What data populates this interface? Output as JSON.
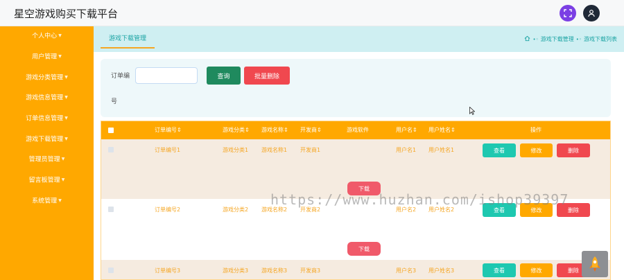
{
  "header": {
    "title": "星空游戏购买下载平台",
    "icons": [
      "expand-icon",
      "user-icon"
    ]
  },
  "sidebar": {
    "items": [
      {
        "label": "个人中心"
      },
      {
        "label": "用户管理"
      },
      {
        "label": "游戏分类管理"
      },
      {
        "label": "游戏信息管理"
      },
      {
        "label": "订单信息管理"
      },
      {
        "label": "游戏下载管理"
      },
      {
        "label": "管理员管理"
      },
      {
        "label": "留言板管理"
      },
      {
        "label": "系统管理"
      }
    ]
  },
  "tabs": {
    "active": "游戏下载管理"
  },
  "breadcrumb": {
    "items": [
      "游戏下载管理",
      "游戏下载列表"
    ]
  },
  "search": {
    "label_line1": "订单编",
    "label_line2": "号",
    "input_value": "",
    "query_button": "查询",
    "batch_delete_button": "批量删除"
  },
  "table": {
    "headers": {
      "order_no": "订单编号⇕",
      "category": "游戏分类⇕",
      "name": "游戏名称⇕",
      "developer": "开发商⇕",
      "software": "游戏软件",
      "username": "用户名⇕",
      "realname": "用户姓名⇕",
      "actions": "操作"
    },
    "rows": [
      {
        "order_no": "订单编号1",
        "category": "游戏分类1",
        "name": "游戏名称1",
        "developer": "开发商1",
        "username": "用户名1",
        "realname": "用户姓名1",
        "download": "下载"
      },
      {
        "order_no": "订单编号2",
        "category": "游戏分类2",
        "name": "游戏名称2",
        "developer": "开发商2",
        "username": "用户名2",
        "realname": "用户姓名2",
        "download": "下载"
      },
      {
        "order_no": "订单编号3",
        "category": "游戏分类3",
        "name": "游戏名称3",
        "developer": "开发商3",
        "username": "用户名3",
        "realname": "用户姓名3"
      }
    ],
    "row_actions": {
      "view": "查看",
      "edit": "修改",
      "delete": "删除"
    }
  },
  "watermark": "https://www.huzhan.com/ishop39397",
  "colors": {
    "sidebar": "#ffa800",
    "accent": "#1aa3a3",
    "danger": "#f0484f",
    "success": "#1ec8b0"
  }
}
